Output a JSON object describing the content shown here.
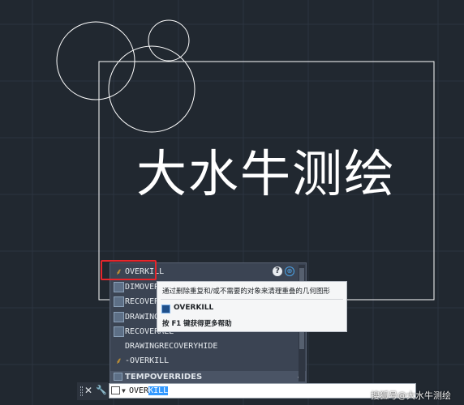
{
  "canvas": {
    "title_text": "大水牛测绘"
  },
  "autocomplete": {
    "items": [
      {
        "label": "OVERKILL",
        "icon": "broom-icon"
      },
      {
        "label": "DIMOVERRIDE",
        "icon": "dimension-override-icon"
      },
      {
        "label": "RECOVER",
        "icon": "recover-icon"
      },
      {
        "label": "DRAWINGRECOVERY",
        "icon": "drawing-recovery-icon"
      },
      {
        "label": "RECOVERALL",
        "icon": "recover-all-icon"
      },
      {
        "label": "DRAWINGRECOVERYHIDE",
        "icon": ""
      },
      {
        "label": "-OVERKILL",
        "icon": "broom-icon"
      }
    ],
    "section_label": "TEMPOVERRIDES",
    "help_glyph": "?",
    "globe_glyph": "⊕"
  },
  "tooltip": {
    "description": "通过删除重复和/或不需要的对象来清理重叠的几何图形",
    "command": "OVERKILL",
    "hint": "按 F1 键获得更多帮助"
  },
  "command_line": {
    "typed_plain": "OVER",
    "typed_selected": "KILL"
  },
  "watermark": "搜狐号@大水牛测绘",
  "colors": {
    "background": "#212830",
    "highlight_box": "#e6262c",
    "selection": "#3399ff"
  }
}
